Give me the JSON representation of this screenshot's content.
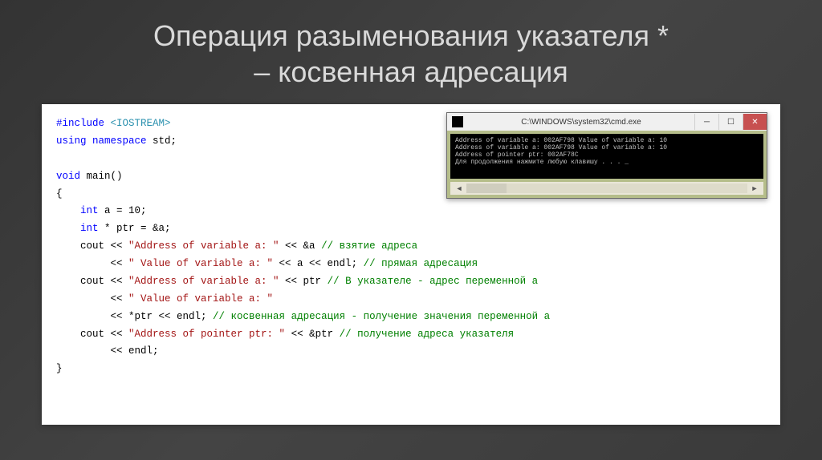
{
  "slide": {
    "title_line1": "Операция разыменования указателя *",
    "title_line2": "– косвенная адресация"
  },
  "code": {
    "l1_a": "#include",
    "l1_b": " <IOSTREAM>",
    "l2_a": "using",
    "l2_b": " ",
    "l2_c": "namespace",
    "l2_d": " std;",
    "l3": "",
    "l4_a": "void",
    "l4_b": " main()",
    "l5": "{",
    "l6_a": "    ",
    "l6_b": "int",
    "l6_c": " a = 10;",
    "l7_a": "    ",
    "l7_b": "int",
    "l7_c": " * ptr = &a;",
    "l8_a": "    cout << ",
    "l8_b": "\"Address of variable a: \"",
    "l8_c": " << &a ",
    "l8_d": "// взятие адреса",
    "l9_a": "         << ",
    "l9_b": "\" Value of variable a: \"",
    "l9_c": " << a << endl; ",
    "l9_d": "// прямая адресация",
    "l10_a": "    cout << ",
    "l10_b": "\"Address of variable a: \"",
    "l10_c": " << ptr ",
    "l10_d": "// В указателе - адрес переменной a",
    "l11_a": "         << ",
    "l11_b": "\" Value of variable a: \"",
    "l12_a": "         << *ptr << endl; ",
    "l12_b": "// косвенная адресация - получение значения переменной a",
    "l13_a": "    cout << ",
    "l13_b": "\"Address of pointer ptr: \"",
    "l13_c": " << &ptr ",
    "l13_d": "// получение адреса указателя",
    "l14": "         << endl;",
    "l15": "}"
  },
  "console": {
    "title": "C:\\WINDOWS\\system32\\cmd.exe",
    "line1": "Address of variable a: 002AF798 Value of variable a: 10",
    "line2": "Address of variable a: 002AF798 Value of variable a: 10",
    "line3": "Address of pointer ptr: 002AF78C",
    "line4": "Для продолжения нажмите любую клавишу . . . _"
  }
}
